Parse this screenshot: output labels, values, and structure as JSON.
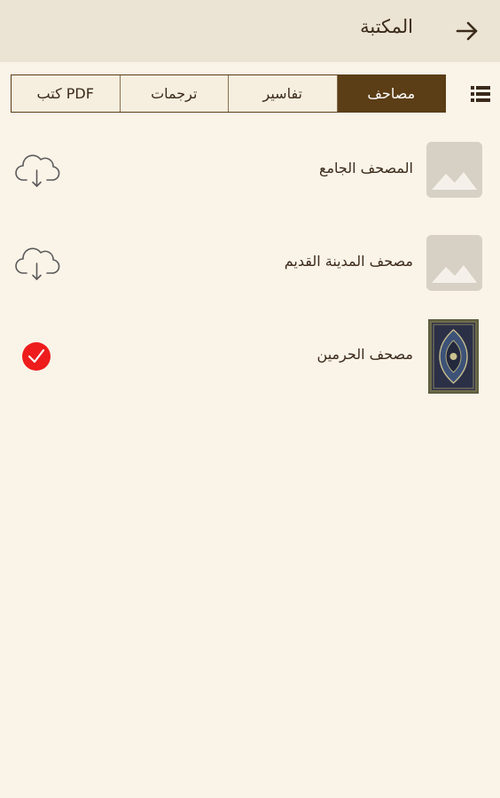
{
  "header": {
    "title": "المكتبة",
    "back_icon": "arrow-right-icon"
  },
  "tabs": [
    {
      "label": "كتب PDF",
      "active": false
    },
    {
      "label": "ترجمات",
      "active": false
    },
    {
      "label": "تفاسير",
      "active": false
    },
    {
      "label": "مصاحف",
      "active": true
    }
  ],
  "list_icon": "list-icon",
  "colors": {
    "background": "#faf3e8",
    "header": "#ebe3d3",
    "accent": "#5b3d16",
    "checked": "#ee1c1c"
  },
  "items": [
    {
      "title": "المصحف الجامع",
      "thumbnail": "placeholder-image-icon",
      "status": "download"
    },
    {
      "title": "مصحف المدينة القديم",
      "thumbnail": "placeholder-image-icon",
      "status": "download"
    },
    {
      "title": "مصحف الحرمين",
      "thumbnail": "mushaf-cover-image",
      "status": "downloaded"
    }
  ]
}
